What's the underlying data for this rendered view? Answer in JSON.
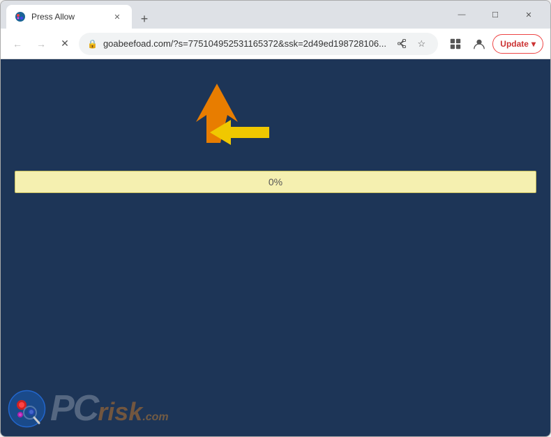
{
  "window": {
    "title": "Press Allow",
    "url": "goabeefoad.com/?s=775104952531165372&ssk=2d49ed198728106...",
    "favicon": "🔴"
  },
  "tabs": [
    {
      "id": "active",
      "title": "Press Allow",
      "favicon": "🔴"
    }
  ],
  "controls": {
    "minimize": "—",
    "maximize": "☐",
    "close": "✕"
  },
  "nav": {
    "back_label": "←",
    "forward_label": "→",
    "reload_label": "✕",
    "lock_icon": "🔒",
    "bookmark_icon": "☆",
    "profile_icon": "👤",
    "update_label": "Update",
    "new_tab_label": "+"
  },
  "content": {
    "progress_value": "0%",
    "progress_percent": 0
  },
  "arrows": {
    "orange": {
      "color": "#e87d00",
      "direction": "up-right"
    },
    "yellow": {
      "color": "#f0c800",
      "direction": "left"
    }
  },
  "logo": {
    "pc": "PC",
    "risk": "risk",
    "dot_com": ".com"
  }
}
